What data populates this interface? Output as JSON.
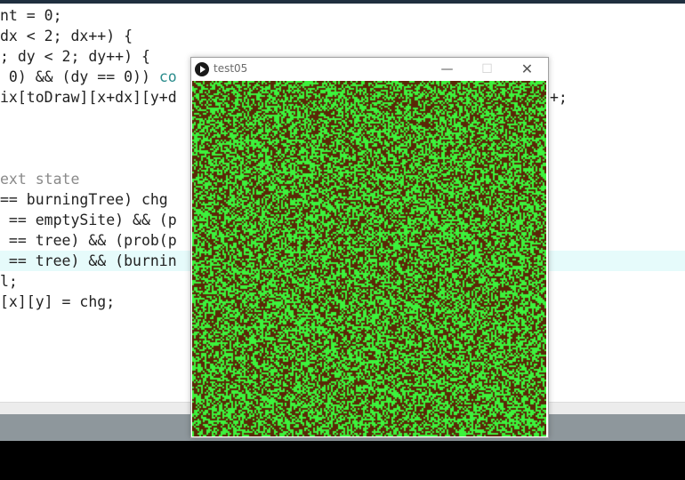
{
  "editor": {
    "lines": [
      "nt = 0;",
      "dx < 2; dx++) {",
      "; dy < 2; dy++) {",
      " 0) && (dy == 0)) co",
      "ix[toDraw][x+dx][y+d",
      "",
      "",
      "",
      "ext state",
      "== burningTree) chg",
      " == emptySite) && (p",
      " == tree) && (prob(p",
      " == tree) && (burnin",
      "l;",
      "[x][y] = chg;"
    ],
    "line4_tail": "+;"
  },
  "sketch_window": {
    "title": "test05",
    "minimize_symbol": "—",
    "maximize_symbol": "☐",
    "close_symbol": "✕",
    "canvas_colors": {
      "background": "#5a2806",
      "tree": "#3cf23c"
    },
    "tree_density": 0.5
  }
}
